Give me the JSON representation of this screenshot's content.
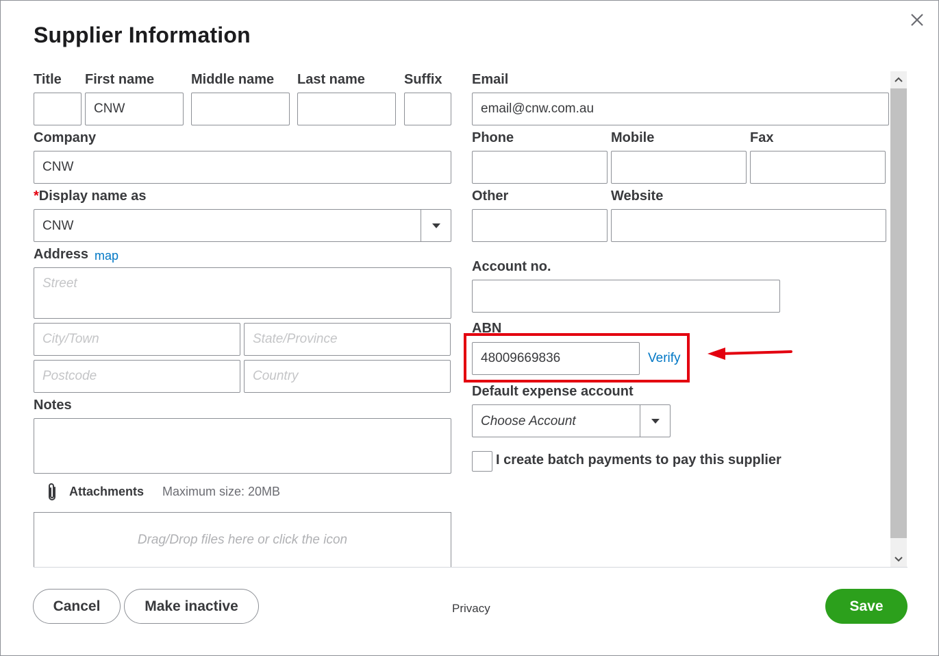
{
  "dialog": {
    "title": "Supplier Information"
  },
  "name": {
    "title_label": "Title",
    "title_value": "",
    "first_label": "First name",
    "first_value": "CNW",
    "middle_label": "Middle name",
    "middle_value": "",
    "last_label": "Last name",
    "last_value": "",
    "suffix_label": "Suffix",
    "suffix_value": ""
  },
  "company": {
    "label": "Company",
    "value": "CNW"
  },
  "display_name": {
    "required_mark": "*",
    "label": "Display name as",
    "value": "CNW"
  },
  "address": {
    "label": "Address",
    "map_link": "map",
    "street_placeholder": "Street",
    "city_placeholder": "City/Town",
    "state_placeholder": "State/Province",
    "postcode_placeholder": "Postcode",
    "country_placeholder": "Country"
  },
  "notes": {
    "label": "Notes",
    "value": ""
  },
  "attachments": {
    "label": "Attachments",
    "max_size": "Maximum size: 20MB",
    "drop_text": "Drag/Drop files here or click the icon"
  },
  "contact": {
    "email_label": "Email",
    "email_value": "email@cnw.com.au",
    "phone_label": "Phone",
    "phone_value": "",
    "mobile_label": "Mobile",
    "mobile_value": "",
    "fax_label": "Fax",
    "fax_value": "",
    "other_label": "Other",
    "other_value": "",
    "website_label": "Website",
    "website_value": ""
  },
  "account_no": {
    "label": "Account no.",
    "value": ""
  },
  "abn": {
    "label": "ABN",
    "value": "48009669836",
    "verify_link": "Verify"
  },
  "expense_account": {
    "label": "Default expense account",
    "placeholder": "Choose Account"
  },
  "batch_payments": {
    "label": "I create batch payments to pay this supplier",
    "checked": false
  },
  "footer": {
    "cancel_label": "Cancel",
    "make_inactive_label": "Make inactive",
    "privacy_label": "Privacy",
    "save_label": "Save"
  },
  "colors": {
    "accent_green": "#2ca01c",
    "link_blue": "#0077c5",
    "annotation_red": "#e3000f"
  }
}
